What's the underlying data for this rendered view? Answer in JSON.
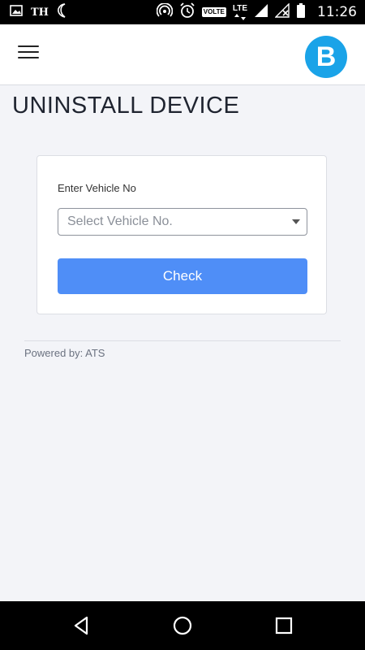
{
  "status_bar": {
    "carrier_label": "TH",
    "network_label": "LTE",
    "volte_label": "VOLTE",
    "time": "11:26",
    "icons": [
      "image-icon",
      "moon-icon",
      "hotspot-icon",
      "alarm-icon",
      "signal-icon",
      "no-signal-icon",
      "battery-icon"
    ]
  },
  "header": {
    "menu_icon": "hamburger-icon",
    "logo_letter": "B",
    "logo_color": "#1aa3e8"
  },
  "page": {
    "title": "UNINSTALL DEVICE"
  },
  "form": {
    "vehicle_label": "Enter Vehicle No",
    "vehicle_select_placeholder": "Select Vehicle No.",
    "check_button": "Check",
    "button_color": "#4f8ef7"
  },
  "footer": {
    "powered_by": "Powered by: ATS"
  },
  "nav_bar": {
    "icons": [
      "back-icon",
      "home-icon",
      "recents-icon"
    ]
  }
}
